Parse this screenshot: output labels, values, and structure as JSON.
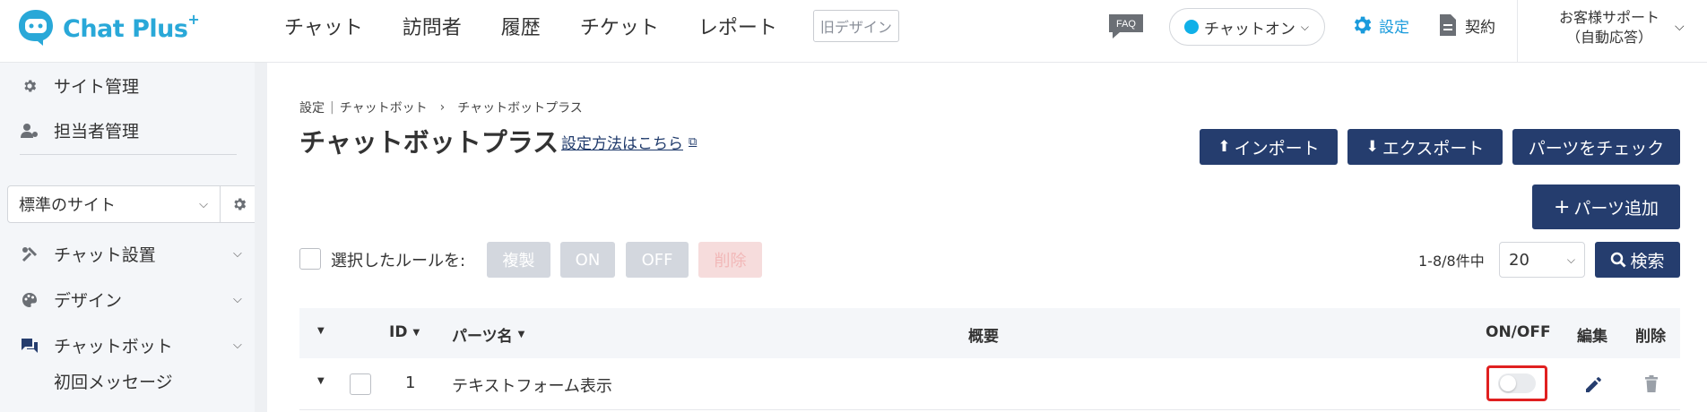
{
  "header": {
    "logo_text": "Chat Plus",
    "logo_sup": "+",
    "nav": [
      "チャット",
      "訪問者",
      "履歴",
      "チケット",
      "レポート"
    ],
    "old_design": "旧デザイン",
    "faq": "FAQ",
    "chat_status": "チャットオン",
    "settings": "設定",
    "contract": "契約",
    "support_line1": "お客様サポート",
    "support_line2": "（自動応答）"
  },
  "sidebar": {
    "site_manage": "サイト管理",
    "staff_manage": "担当者管理",
    "site_select": "標準のサイト",
    "chat_setup": "チャット設置",
    "design": "デザイン",
    "chatbot": "チャットボット",
    "first_message": "初回メッセージ"
  },
  "main": {
    "breadcrumb": [
      "設定",
      "チャットボット",
      "チャットボットプラス"
    ],
    "title": "チャットボットプラス",
    "howto": "設定方法はこちら",
    "import": "インポート",
    "export": "エクスポート",
    "check_parts": "パーツをチェック",
    "add_parts": "パーツ追加",
    "selected_rules": "選択したルールを:",
    "bulk_actions": [
      "複製",
      "ON",
      "OFF",
      "削除"
    ],
    "count": "1-8/8件中",
    "per_page": "20",
    "search": "検索"
  },
  "table": {
    "columns": [
      "ID",
      "パーツ名",
      "概要",
      "ON/OFF",
      "編集",
      "削除"
    ],
    "rows": [
      {
        "id": "1",
        "name": "テキストフォーム表示",
        "summary": "",
        "enabled": false
      }
    ]
  },
  "colors": {
    "navy": "#253d6e",
    "brand": "#29a8d8",
    "highlight": "#e02020"
  }
}
